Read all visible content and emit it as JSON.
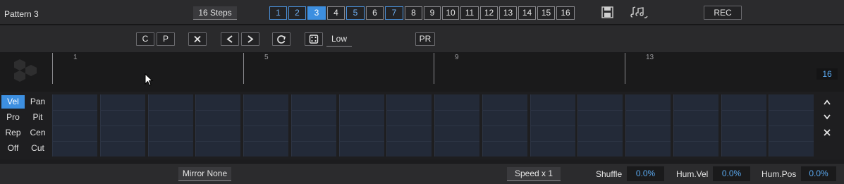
{
  "header": {
    "steps_label": "16 Steps",
    "patterns": [
      "1",
      "2",
      "3",
      "4",
      "5",
      "6",
      "7",
      "8",
      "9",
      "10",
      "11",
      "12",
      "13",
      "14",
      "15",
      "16"
    ],
    "pattern_states": [
      "used",
      "used",
      "active",
      "",
      "used",
      "",
      "used",
      "",
      "",
      "",
      "",
      "",
      "",
      "",
      "",
      ""
    ],
    "save_pattern_icon": "save-pattern-icon",
    "pattern_to_note_icon": "music-notes-icon",
    "rec_label": "REC"
  },
  "toolbar": {
    "pattern_name": "Pattern 3",
    "copy_label": "C",
    "paste_label": "P",
    "clear_icon": "close-icon",
    "shift_left": "<",
    "shift_right": ">",
    "refresh_icon": "refresh-icon",
    "dice_icon": "dice-icon",
    "random_amount": "Low",
    "pr_label": "PR"
  },
  "ruler": {
    "markers": [
      "1",
      "5",
      "9",
      "13"
    ],
    "last_step": "16"
  },
  "lanes": {
    "items": [
      "Vel",
      "Pan",
      "Pro",
      "Pit",
      "Rep",
      "Cen",
      "Off",
      "Cut"
    ],
    "active": "Vel"
  },
  "steps": {
    "count": 16
  },
  "side_controls": {
    "up": "^",
    "down": "v",
    "clear": "×"
  },
  "footer": {
    "mirror_label": "Mirror None",
    "speed_label": "Speed x 1",
    "shuffle_label": "Shuffle",
    "shuffle_value": "0.0%",
    "hum_vel_label": "Hum.Vel",
    "hum_vel_value": "0.0%",
    "hum_pos_label": "Hum.Pos",
    "hum_pos_value": "0.0%"
  },
  "colors": {
    "accent": "#3d8fe0",
    "used_pattern": "#6fb1f5",
    "step_fill": "#232a38"
  }
}
